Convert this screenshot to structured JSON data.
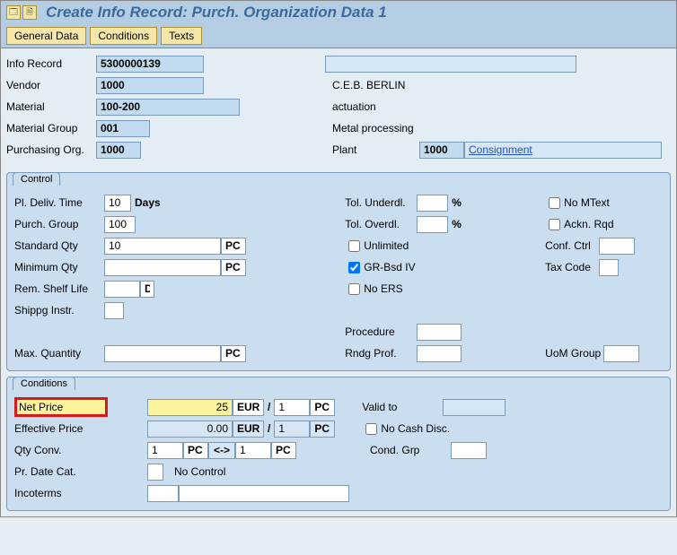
{
  "title": "Create Info Record: Purch. Organization Data 1",
  "tabs": {
    "general": "General Data",
    "conditions": "Conditions",
    "texts": "Texts"
  },
  "header": {
    "info_record_lbl": "Info Record",
    "info_record": "5300000139",
    "vendor_lbl": "Vendor",
    "vendor": "1000",
    "vendor_desc": "C.E.B. BERLIN",
    "material_lbl": "Material",
    "material": "100-200",
    "material_desc": "actuation",
    "matgroup_lbl": "Material Group",
    "matgroup": "001",
    "matgroup_desc": "Metal processing",
    "porg_lbl": "Purchasing Org.",
    "porg": "1000",
    "plant_lbl": "Plant",
    "plant": "1000",
    "plant_type": "Consignment"
  },
  "control": {
    "title": "Control",
    "deliv_lbl": "Pl. Deliv. Time",
    "deliv": "10",
    "days": "Days",
    "pgroup_lbl": "Purch. Group",
    "pgroup": "100",
    "stdqty_lbl": "Standard Qty",
    "stdqty": "10",
    "pc": "PC",
    "minqty_lbl": "Minimum Qty",
    "minqty": "",
    "shelf_lbl": "Rem. Shelf Life",
    "shelf": "",
    "d": "D",
    "shipg_lbl": "Shippg Instr.",
    "maxqty_lbl": "Max. Quantity",
    "tolu_lbl": "Tol. Underdl.",
    "pct": "%",
    "tolo_lbl": "Tol. Overdl.",
    "unlimited": "Unlimited",
    "grbsd": "GR-Bsd IV",
    "noers": "No ERS",
    "proc_lbl": "Procedure",
    "rndg_lbl": "Rndg Prof.",
    "nomtext": "No MText",
    "ackn": "Ackn. Rqd",
    "conf_lbl": "Conf. Ctrl",
    "tax_lbl": "Tax Code",
    "uom_lbl": "UoM Group"
  },
  "cond": {
    "title": "Conditions",
    "net_lbl": "Net Price",
    "net": "25",
    "eur": "EUR",
    "slash": "/",
    "one": "1",
    "pc": "PC",
    "valid_lbl": "Valid to",
    "eff_lbl": "Effective Price",
    "eff": "0.00",
    "nocash": "No Cash Disc.",
    "qty_lbl": "Qty Conv.",
    "qty1": "1",
    "arrow": "<->",
    "qty2": "1",
    "cgrp_lbl": "Cond. Grp",
    "prdate_lbl": "Pr. Date Cat.",
    "nocontrol": "No Control",
    "inco_lbl": "Incoterms"
  }
}
